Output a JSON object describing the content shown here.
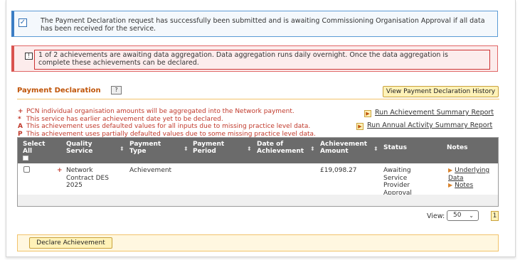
{
  "info_message": {
    "check_icon": "checkbox-checked-icon",
    "text": "The Payment Declaration request has successfully been submitted and is awaiting Commissioning Organisation Approval if all data has been received for the service."
  },
  "warning_message": {
    "icon": "alert-icon",
    "icon_glyph": "!",
    "text": "1 of 2 achievements are awaiting data aggregation. Data aggregation runs daily overnight. Once the data aggregation is complete these achievements can be declared."
  },
  "section": {
    "title": "Payment Declaration",
    "help_label": "?",
    "history_button": "View Payment Declaration History"
  },
  "legend": [
    {
      "symbol": "+",
      "text": "PCN individual organisation amounts will be aggregated into the Network payment."
    },
    {
      "symbol": "*",
      "text": "This service has earlier achievement date yet to be declared."
    },
    {
      "symbol": "A",
      "text": "This achievement uses defaulted values for all inputs due to missing practice level data."
    },
    {
      "symbol": "P",
      "text": "This achievement uses partially defaulted values due to some missing practice level data."
    }
  ],
  "reports": [
    {
      "label": "Run Achievement Summary Report",
      "icon": "arrow-right-icon"
    },
    {
      "label": "Run Annual Activity Summary Report",
      "icon": "arrow-right-icon"
    }
  ],
  "table": {
    "headers": {
      "select_all": "Select All",
      "quality_service": "Quality Service",
      "payment_type": "Payment Type",
      "payment_period": "Payment Period",
      "date_of_achievement": "Date of Achievement",
      "achievement_amount": "Achievement Amount",
      "status": "Status",
      "notes": "Notes"
    },
    "rows": [
      {
        "marker": "+",
        "quality_service": "Network Contract DES 2025",
        "payment_type": "Achievement",
        "payment_period": "",
        "date_of_achievement": "",
        "achievement_amount": "£19,098.27",
        "status": "Awaiting Service Provider Approval",
        "notes_links": [
          "Underlying Data",
          "Notes"
        ]
      }
    ]
  },
  "pagination": {
    "view_label": "View:",
    "page_size": "50",
    "current_page": "1"
  },
  "actions": {
    "declare_button": "Declare Achievement"
  },
  "colors": {
    "accent_orange": "#c0550a",
    "legend_red": "#c0392b",
    "button_bg": "#fff2b8",
    "table_header": "#6b6b6b",
    "info_border": "#3b7dc4",
    "warn_border": "#d9534f"
  }
}
